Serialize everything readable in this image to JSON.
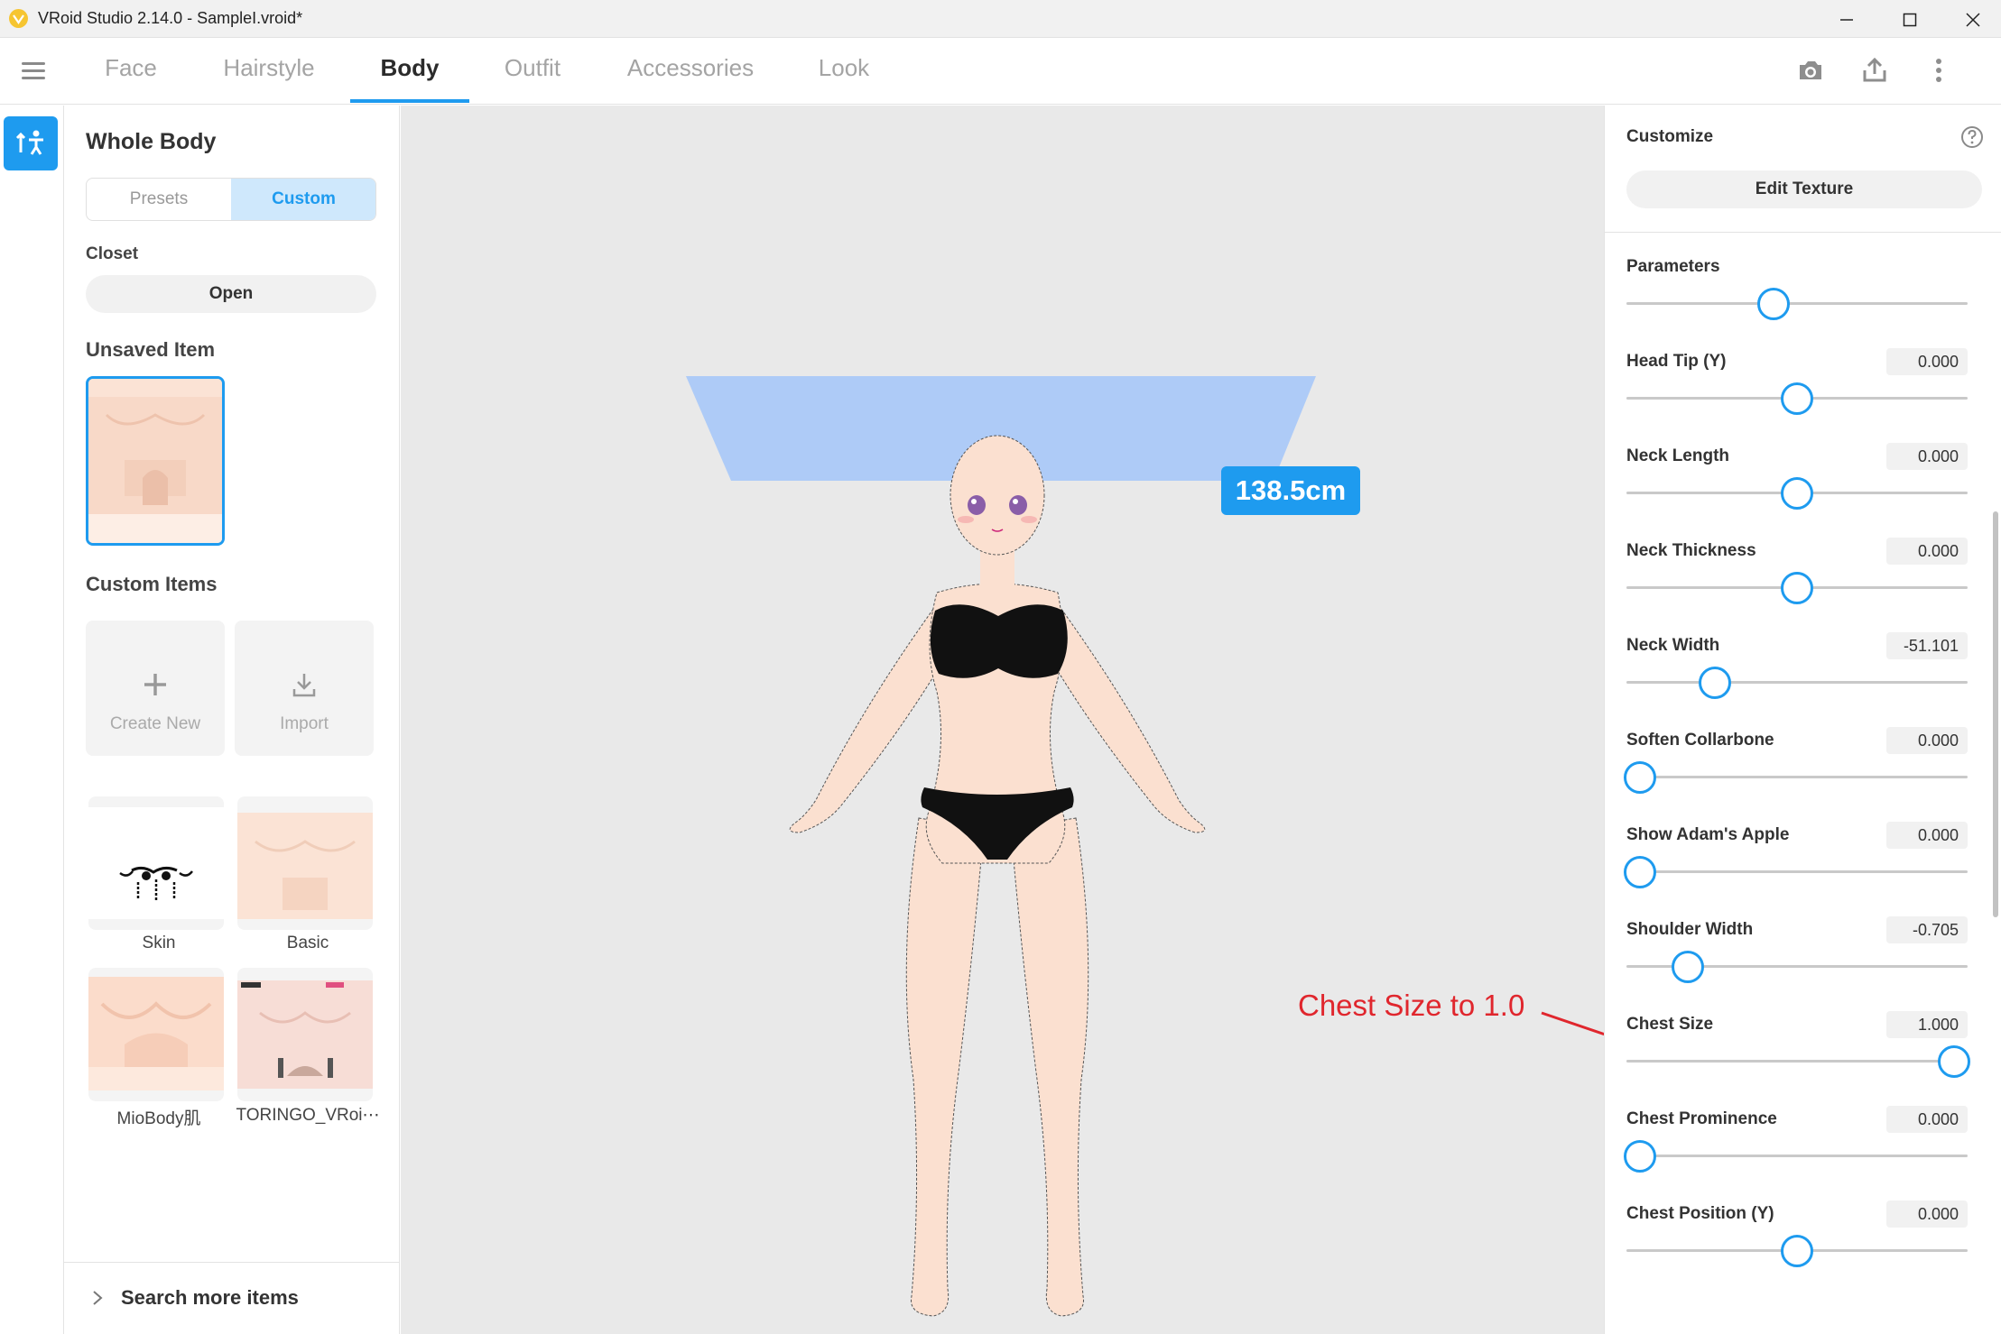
{
  "window": {
    "title": "VRoid Studio 2.14.0 - SampleI.vroid*"
  },
  "tabs": [
    {
      "label": "Face"
    },
    {
      "label": "Hairstyle"
    },
    {
      "label": "Body"
    },
    {
      "label": "Outfit"
    },
    {
      "label": "Accessories"
    },
    {
      "label": "Look"
    }
  ],
  "active_tab": "Body",
  "left": {
    "title": "Whole Body",
    "seg_presets": "Presets",
    "seg_custom": "Custom",
    "closet_label": "Closet",
    "open_label": "Open",
    "unsaved_label": "Unsaved Item",
    "custom_items_label": "Custom Items",
    "create_new": "Create New",
    "import": "Import",
    "items": [
      {
        "label": "Skin"
      },
      {
        "label": "Basic"
      },
      {
        "label": "MioBody肌"
      },
      {
        "label": "TORINGO_VRoi⋯"
      }
    ],
    "search_more": "Search more items"
  },
  "viewport": {
    "height_label": "138.5cm",
    "annotation": "Chest Size to 1.0",
    "annotation_color": "#e0262d"
  },
  "right": {
    "customize": "Customize",
    "edit_texture": "Edit Texture",
    "params": [
      {
        "label": "Parameters",
        "value": "",
        "pos": 0.43
      },
      {
        "label": "Head Tip (Y)",
        "value": "0.000",
        "pos": 0.5
      },
      {
        "label": "Neck Length",
        "value": "0.000",
        "pos": 0.5
      },
      {
        "label": "Neck Thickness",
        "value": "0.000",
        "pos": 0.5
      },
      {
        "label": "Neck Width",
        "value": "-51.101",
        "pos": 0.26
      },
      {
        "label": "Soften Collarbone",
        "value": "0.000",
        "pos": 0.04
      },
      {
        "label": "Show Adam's Apple",
        "value": "0.000",
        "pos": 0.04
      },
      {
        "label": "Shoulder Width",
        "value": "-0.705",
        "pos": 0.18
      },
      {
        "label": "Chest Size",
        "value": "1.000",
        "pos": 0.96
      },
      {
        "label": "Chest Prominence",
        "value": "0.000",
        "pos": 0.04
      },
      {
        "label": "Chest Position (Y)",
        "value": "0.000",
        "pos": 0.5
      }
    ]
  },
  "colors": {
    "accent": "#1e9bef",
    "height_plane": "#aecbf7"
  }
}
